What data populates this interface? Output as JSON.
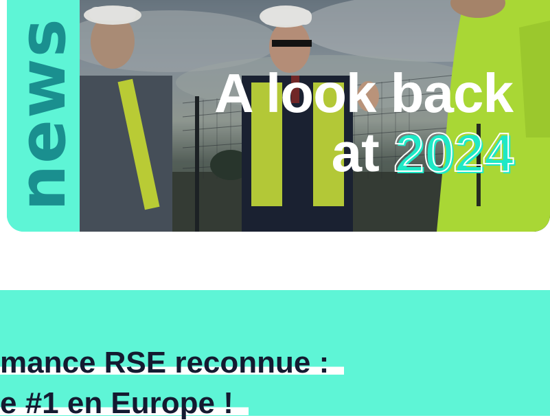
{
  "hero": {
    "tag": "news",
    "headline_line1": "A look back",
    "headline_at": "at",
    "headline_year": "2024"
  },
  "banner": {
    "line1": "mance RSE reconnue :",
    "line2": "e #1 en Europe !"
  },
  "colors": {
    "accent": "#5ef5d6",
    "tag_text": "#1a8f8f",
    "banner_text": "#141a30",
    "headline_text": "#ffffff"
  }
}
